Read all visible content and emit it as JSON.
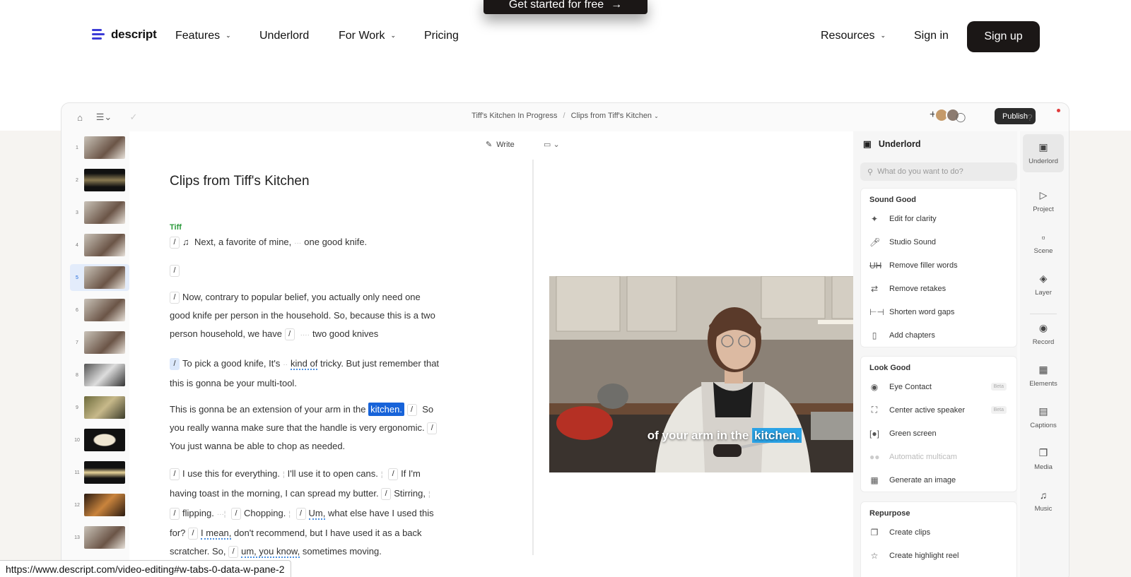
{
  "top_cta": {
    "label": "Get started for free",
    "arrow": "→"
  },
  "nav": {
    "logo_text": "descript",
    "features": "Features",
    "underlord": "Underlord",
    "for_work": "For Work",
    "pricing": "Pricing",
    "resources": "Resources",
    "sign_in": "Sign in",
    "sign_up": "Sign up"
  },
  "app": {
    "breadcrumb": {
      "project": "Tiff's Kitchen In Progress",
      "separator": "/",
      "composition": "Clips from Tiff's Kitchen"
    },
    "publish": "Publish",
    "thumbnails": [
      "1",
      "2",
      "3",
      "4",
      "5",
      "6",
      "7",
      "8",
      "9",
      "10",
      "11",
      "12",
      "13"
    ],
    "selected_thumbnail": "5",
    "script": {
      "write_label": "Write",
      "title": "Clips from Tiff's Kitchen",
      "speaker": "Tiff",
      "p1": {
        "text": "Next, a favorite of mine,",
        "text2": "one good knife."
      },
      "p3": {
        "text": "Now, contrary to popular belief, you actually only need one good knife per person in the household. So, because this is a two person household, we have",
        "text2": "two good knives"
      },
      "p4": {
        "text": "To pick a good knife, It's",
        "underlined": "kind of",
        "text2": "tricky. But just remember that this is gonna be your multi-tool."
      },
      "p5": {
        "text": "This is gonna be an extension of your arm in the",
        "highlighted": "kitchen.",
        "text2": "So you really wanna make sure that the handle is very ergonomic.",
        "text3": "You just wanna be able to chop as needed."
      },
      "p6": {
        "a": "I use this for everything.",
        "b": "I'll use it to open cans.",
        "c": "If I'm having toast in the morning, I can spread my butter.",
        "d": "Stirring,",
        "e": "flipping.",
        "f": "Chopping.",
        "g": "Um,",
        "h": "what else have I used this for?",
        "i": "I mean,",
        "j": "don't recommend, but I have used it as a back scratcher. So,",
        "k": "um, you know,",
        "l": "sometimes",
        "m": "moving."
      }
    },
    "video_caption": {
      "text": "of your arm in the",
      "highlight": "kitchen."
    },
    "underlord_panel": {
      "title": "Underlord",
      "search_placeholder": "What do you want to do?",
      "sections": [
        {
          "title": "Sound Good",
          "items": [
            {
              "label": "Edit for clarity",
              "icon": "wand-icon"
            },
            {
              "label": "Studio Sound",
              "icon": "mic-sparkle-icon"
            },
            {
              "label": "Remove filler words",
              "icon": "strikethrough-icon"
            },
            {
              "label": "Remove retakes",
              "icon": "repeat-icon"
            },
            {
              "label": "Shorten word gaps",
              "icon": "gap-icon"
            },
            {
              "label": "Add chapters",
              "icon": "bookmark-icon"
            }
          ]
        },
        {
          "title": "Look Good",
          "items": [
            {
              "label": "Eye Contact",
              "icon": "eye-icon",
              "badge": "Beta"
            },
            {
              "label": "Center active speaker",
              "icon": "focus-icon",
              "badge": "Beta"
            },
            {
              "label": "Green screen",
              "icon": "green-screen-icon"
            },
            {
              "label": "Automatic multicam",
              "icon": "multicam-icon",
              "disabled": true
            },
            {
              "label": "Generate an image",
              "icon": "image-sparkle-icon"
            }
          ]
        },
        {
          "title": "Repurpose",
          "items": [
            {
              "label": "Create clips",
              "icon": "clips-icon"
            },
            {
              "label": "Create highlight reel",
              "icon": "star-icon"
            }
          ]
        }
      ]
    },
    "rail": [
      "Underlord",
      "Project",
      "Scene",
      "Layer",
      "Record",
      "Elements",
      "Captions",
      "Media",
      "Music"
    ]
  },
  "status_url": "https://www.descript.com/video-editing#w-tabs-0-data-w-pane-2",
  "colors": {
    "accent_blue": "#1763d9",
    "speaker_green": "#2c9a3c",
    "dark_button": "#1b1716"
  }
}
